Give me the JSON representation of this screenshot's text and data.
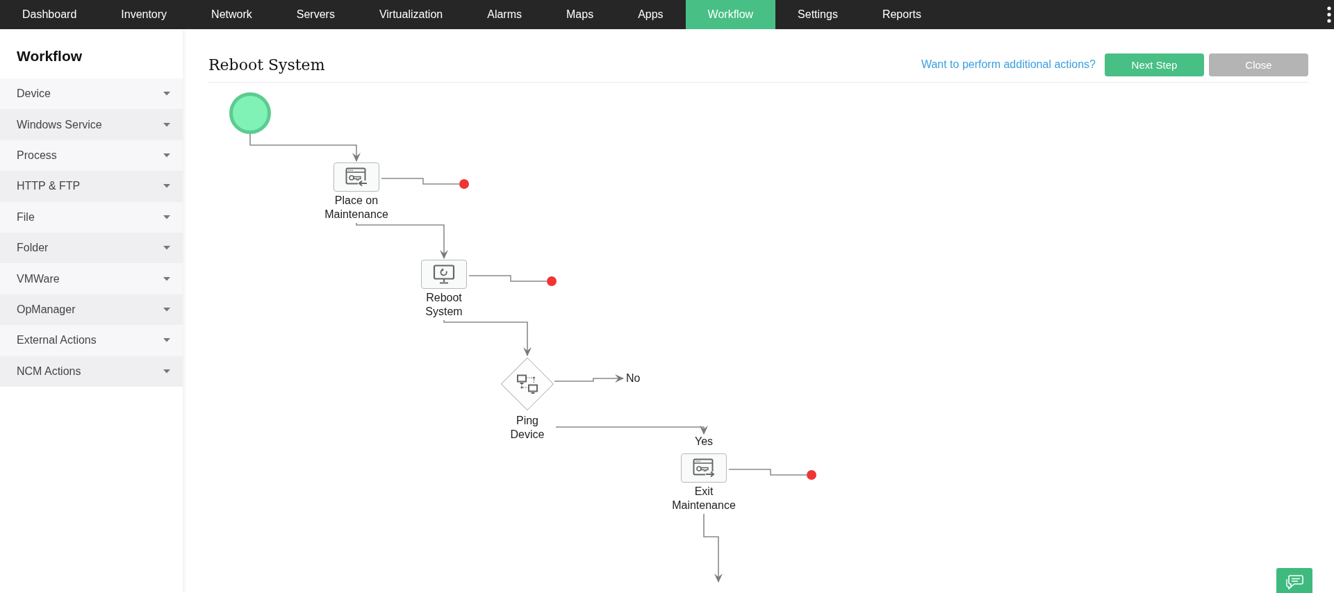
{
  "nav": {
    "items": [
      {
        "label": "Dashboard",
        "selected": false
      },
      {
        "label": "Inventory",
        "selected": false
      },
      {
        "label": "Network",
        "selected": false
      },
      {
        "label": "Servers",
        "selected": false
      },
      {
        "label": "Virtualization",
        "selected": false
      },
      {
        "label": "Alarms",
        "selected": false
      },
      {
        "label": "Maps",
        "selected": false
      },
      {
        "label": "Apps",
        "selected": false
      },
      {
        "label": "Workflow",
        "selected": true
      },
      {
        "label": "Settings",
        "selected": false
      },
      {
        "label": "Reports",
        "selected": false
      }
    ]
  },
  "sidebar": {
    "title": "Workflow",
    "items": [
      {
        "label": "Device",
        "expanded": false
      },
      {
        "label": "Windows Service",
        "expanded": false
      },
      {
        "label": "Process",
        "expanded": false
      },
      {
        "label": "HTTP & FTP",
        "expanded": false
      },
      {
        "label": "File",
        "expanded": false
      },
      {
        "label": "Folder",
        "expanded": false
      },
      {
        "label": "VMWare",
        "expanded": false
      },
      {
        "label": "OpManager",
        "expanded": false
      },
      {
        "label": "External Actions",
        "expanded": false
      },
      {
        "label": "NCM Actions",
        "expanded": false
      }
    ]
  },
  "header": {
    "title": "Reboot System",
    "link": "Want to perform additional actions?",
    "buttons": [
      {
        "label": "Next Step",
        "kind": "primary"
      },
      {
        "label": "Close",
        "kind": "secondary"
      }
    ]
  },
  "workflow": {
    "nodes": [
      {
        "kind": "start"
      },
      {
        "kind": "task",
        "label": "Place on Maintenance"
      },
      {
        "kind": "task",
        "label": "Reboot System"
      },
      {
        "kind": "condition",
        "label": "Ping Device",
        "branches": [
          "No",
          "Yes"
        ]
      },
      {
        "kind": "task",
        "label": "Exit Maintenance"
      }
    ]
  }
}
